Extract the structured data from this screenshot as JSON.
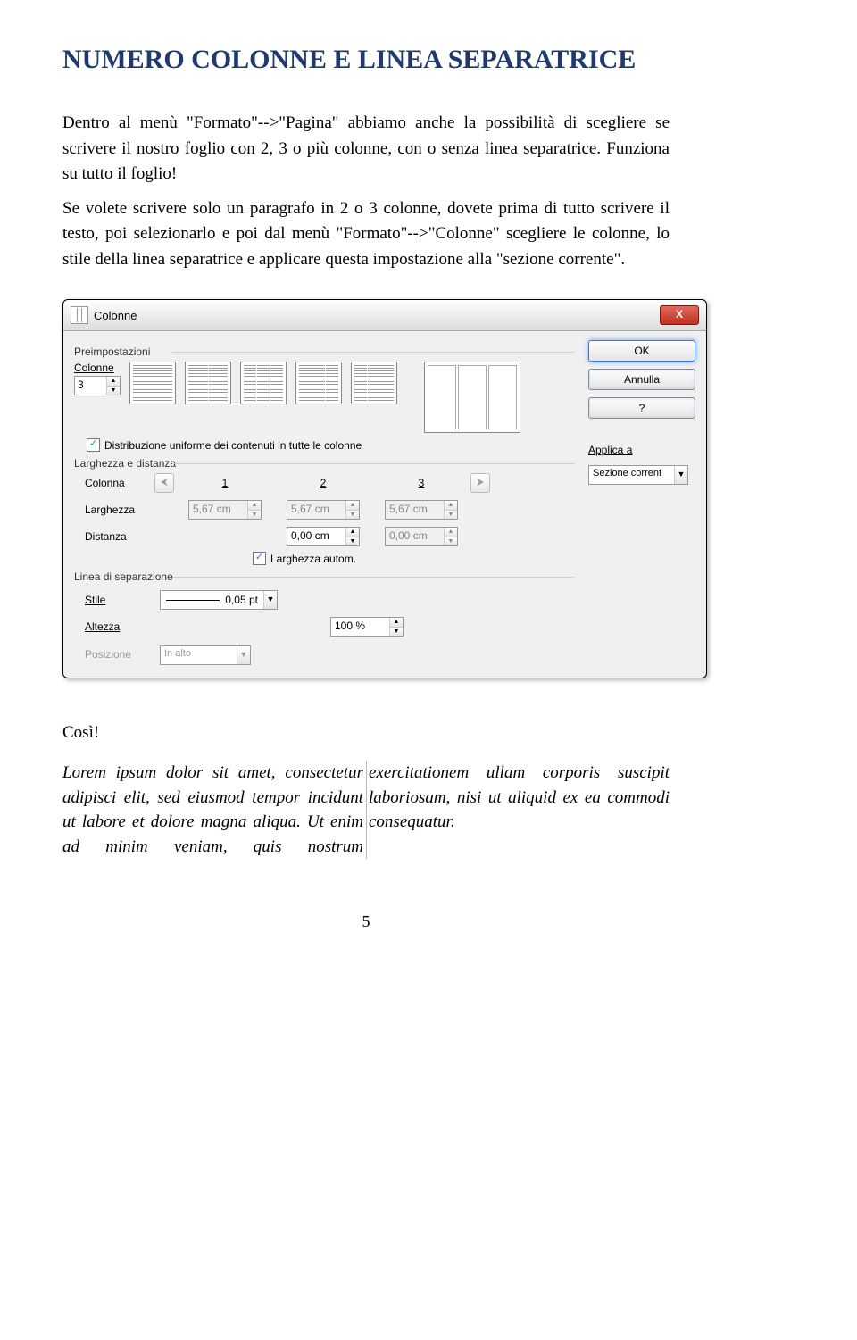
{
  "heading": "NUMERO COLONNE E LINEA SEPARATRICE",
  "para1": "Dentro al menù \"Formato\"-->\"Pagina\" abbiamo anche la possibilità di scegliere se scrivere il nostro foglio con 2, 3 o più colonne, con o senza linea separatrice. Funziona su tutto il foglio!",
  "para2": "Se volete scrivere solo un paragrafo in 2 o 3 colonne, dovete prima di tutto scrivere il testo, poi selezionarlo e poi dal menù \"Formato\"-->\"Colonne\" scegliere le colonne, lo stile della linea separatrice e  applicare questa impostazione alla \"sezione corrente\".",
  "dialog": {
    "title": "Colonne",
    "close": "X",
    "buttons": {
      "ok": "OK",
      "cancel": "Annulla",
      "help": "?"
    },
    "apply_label": "Applica a",
    "apply_value": "Sezione corrent",
    "groups": {
      "presets": "Preimpostazioni",
      "widths": "Larghezza e distanza",
      "sep": "Linea di separazione"
    },
    "columns_label": "Colonne",
    "columns_value": "3",
    "uniform_label": "Distribuzione uniforme dei contenuti in tutte le colonne",
    "headers": {
      "col": "Colonna",
      "1": "1",
      "2": "2",
      "3": "3"
    },
    "width_label": "Larghezza",
    "distance_label": "Distanza",
    "widths": {
      "w1": "5,67 cm",
      "w2": "5,67 cm",
      "w3": "5,67 cm"
    },
    "distances": {
      "d1": "0,00 cm",
      "d2": "0,00 cm"
    },
    "autowidth_label": "Larghezza autom.",
    "style_label": "Stile",
    "style_value": "0,05 pt",
    "height_label": "Altezza",
    "height_value": "100 %",
    "position_label": "Posizione",
    "position_value": "In alto"
  },
  "cosi": "Così!",
  "lorem": "Lorem ipsum dolor sit amet, consectetur adipisci elit, sed eiusmod tempor incidunt ut labore et dolore magna aliqua. Ut enim ad minim veniam, quis nostrum exercitationem ullam corporis suscipit laboriosam, nisi ut aliquid ex ea commodi consequatur.",
  "pagenum": "5"
}
